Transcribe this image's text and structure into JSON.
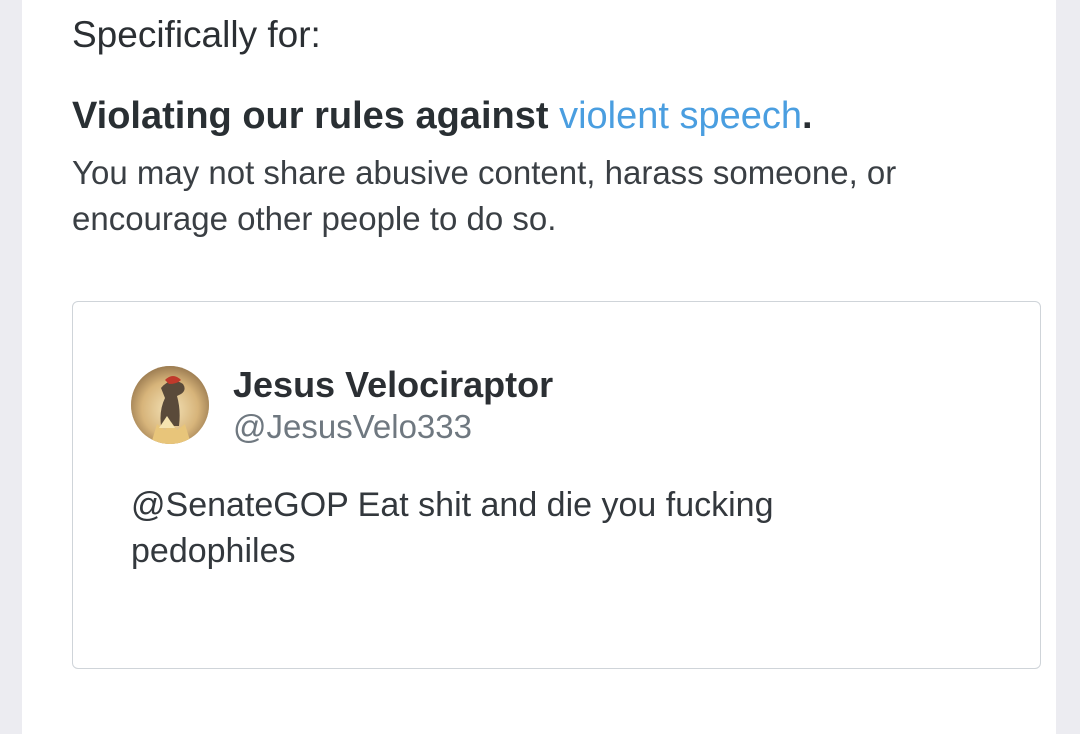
{
  "notice": {
    "intro": "Specifically for:",
    "rule_prefix": "Violating our rules against ",
    "rule_link": "violent speech",
    "rule_suffix": ".",
    "rule_description": "You may not share abusive content, harass someone, or encourage other people to do so."
  },
  "tweet": {
    "display_name": "Jesus Velociraptor",
    "handle": "@JesusVelo333",
    "text": "@SenateGOP Eat shit and die you fucking pedophiles",
    "avatar_icon": "avatar-image"
  },
  "colors": {
    "link": "#4a9ee0",
    "background": "#ececf1",
    "panel": "#ffffff"
  }
}
